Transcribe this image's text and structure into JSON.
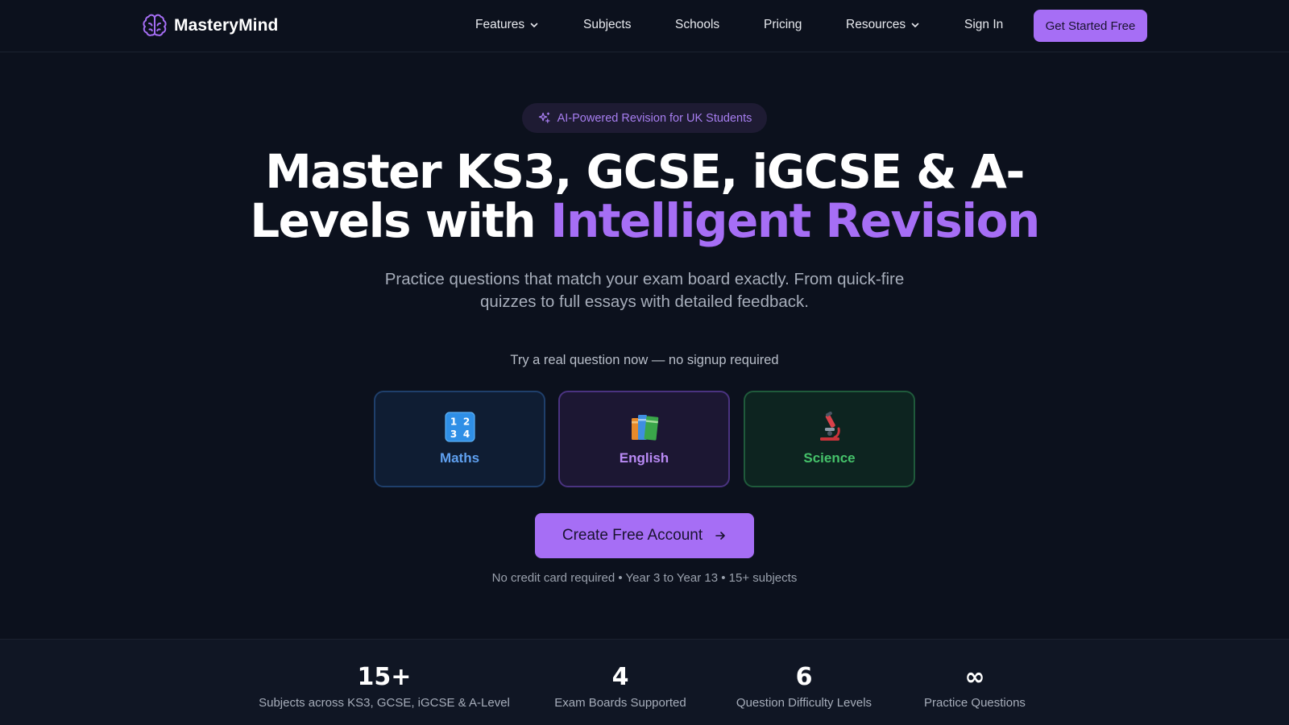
{
  "brand": {
    "name": "MasteryMind",
    "accent_color": "#a66ef5",
    "icon": "brain-icon"
  },
  "nav": {
    "features": "Features",
    "subjects": "Subjects",
    "schools": "Schools",
    "pricing": "Pricing",
    "resources": "Resources",
    "sign_in": "Sign In",
    "cta": "Get Started Free"
  },
  "hero": {
    "badge": "AI-Powered Revision for UK Students",
    "badge_icon": "sparkles-icon",
    "title_line1": "Master KS3, GCSE, iGCSE & A-",
    "title_line2_plain": "Levels with ",
    "title_line2_accent": "Intelligent Revision",
    "subtitle": "Practice questions that match your exam board exactly. From quick-fire quizzes to full essays with detailed feedback.",
    "try_line": "Try a real question now — no signup required"
  },
  "subject_cards": {
    "maths": {
      "label": "Maths",
      "icon": "numbers-icon",
      "color": "#5fa0f0"
    },
    "english": {
      "label": "English",
      "icon": "books-icon",
      "color": "#b98af5"
    },
    "science": {
      "label": "Science",
      "icon": "microscope-icon",
      "color": "#45c26a"
    }
  },
  "cta": {
    "label": "Create Free Account",
    "reassurance": "No credit card required • Year 3 to Year 13 • 15+ subjects"
  },
  "stats": [
    {
      "value": "15+",
      "label": "Subjects across KS3, GCSE, iGCSE & A-Level"
    },
    {
      "value": "4",
      "label": "Exam Boards Supported"
    },
    {
      "value": "6",
      "label": "Question Difficulty Levels"
    },
    {
      "value": "∞",
      "label": "Practice Questions"
    }
  ]
}
